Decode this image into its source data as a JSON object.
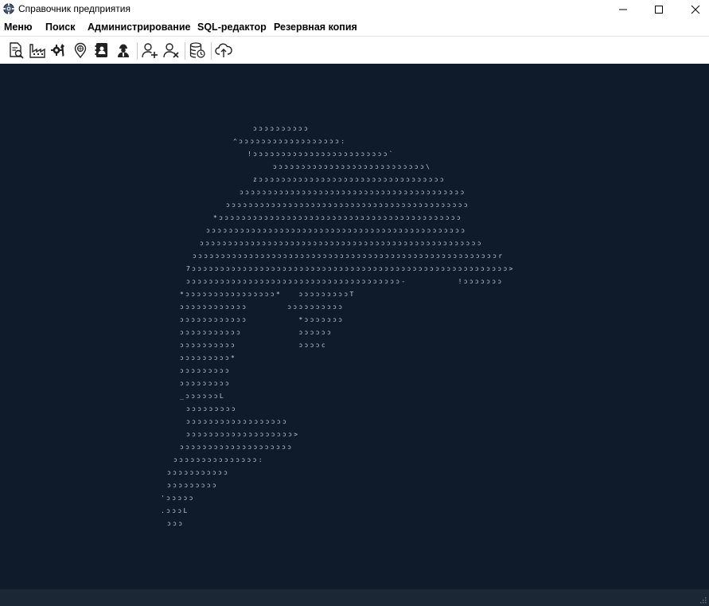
{
  "window": {
    "title": "Справочник предприятия",
    "minimize_glyph": "—",
    "maximize_glyph": "☐",
    "close_glyph": "✕"
  },
  "menu": {
    "items": [
      "Меню",
      "Поиск",
      "Администрирование",
      "SQL-редактор",
      "Резервная копия"
    ]
  },
  "toolbar": {
    "icons": [
      "search-document-icon",
      "factory-icon",
      "tools-icon",
      "location-pin-icon",
      "address-book-icon",
      "worker-icon",
      "add-user-icon",
      "remove-user-icon",
      "database-clock-icon",
      "cloud-upload-icon"
    ]
  },
  "ascii_art": {
    "lines": [
      "          ",
      "",
      "",
      "",
      "",
      "",
      "",
      "",
      "",
      "",
      "",
      "",
      "",
      "",
      "",
      "",
      "",
      "",
      "",
      "",
      "",
      "",
      "",
      "",
      "",
      "",
      "",
      "",
      "",
      "",
      "",
      ""
    ],
    "rows": [
      "ɔɔɔɔɔɔɔɔɔɔ",
      "^ɔɔɔɔɔɔɔɔɔɔɔɔɔɔɔɔɔɔ:",
      "!ɔɔɔɔɔɔɔɔɔɔɔɔɔɔɔɔɔɔɔɔɔɔɔɔ`",
      "ɔɔɔɔɔɔɔɔɔɔɔɔɔɔɔɔɔɔɔɔɔɔɔɔɔɔɔ\\",
      "zɔɔɔɔɔɔɔɔɔɔɔɔɔɔɔɔɔɔɔɔɔɔɔɔɔɔɔɔɔɔɔɔɔ",
      "ɔɔɔɔɔɔɔɔɔɔɔɔɔɔɔɔɔɔɔɔɔɔɔɔɔɔɔɔɔɔɔɔɔɔɔɔɔɔɔɔ",
      "ɔɔɔɔɔɔɔɔɔɔɔɔɔɔɔɔɔɔɔɔɔɔɔɔɔɔɔɔɔɔɔɔɔɔɔɔɔɔɔɔɔɔɔ",
      "*ɔɔɔɔɔɔɔɔɔɔɔɔɔɔɔɔɔɔɔɔɔɔɔɔɔɔɔɔɔɔɔɔɔɔɔɔɔɔɔɔɔɔɔ",
      "ɔɔɔɔɔɔɔɔɔɔɔɔɔɔɔɔɔɔɔɔɔɔɔɔɔɔɔɔɔɔɔɔɔɔɔɔɔɔɔɔɔɔɔɔɔɔ",
      "ɔɔɔɔɔɔɔɔɔɔɔɔɔɔɔɔɔɔɔɔɔɔɔɔɔɔɔɔɔɔɔɔɔɔɔɔɔɔɔɔɔɔɔɔɔɔɔɔɔɔ",
      "ɔɔɔɔɔɔɔɔɔɔɔɔɔɔɔɔɔɔɔɔɔɔɔɔɔɔɔɔɔɔɔɔɔɔɔɔɔɔɔɔɔɔɔɔɔɔɔɔɔɔɔɔɔɔr",
      "7ɔɔɔɔɔɔɔɔɔɔɔɔɔɔɔɔɔɔɔɔɔɔɔɔɔɔɔɔɔɔɔɔɔɔɔɔɔɔɔɔɔɔɔɔɔɔɔɔɔɔɔɔɔɔɔɔ>",
      "ɔɔɔɔɔɔɔɔɔɔɔɔɔɔɔɔɔɔɔɔɔɔɔɔɔɔɔɔɔɔɔɔɔɔɔɔɔɔ-         !ɔɔɔɔɔɔɔ",
      "*ɔɔɔɔɔɔɔɔɔɔɔɔɔɔɔɔ*   ɔɔɔɔɔɔɔɔɔT",
      "ɔɔɔɔɔɔɔɔɔɔɔɔ       ɔɔɔɔɔɔɔɔɔɔ",
      "ɔɔɔɔɔɔɔɔɔɔɔɔ         *ɔɔɔɔɔɔɔ",
      "ɔɔɔɔɔɔɔɔɔɔɔ          ɔɔɔɔɔɔ",
      "ɔɔɔɔɔɔɔɔɔɔ           ɔɔɔɔc",
      "ɔɔɔɔɔɔɔɔɔ*",
      "ɔɔɔɔɔɔɔɔɔ",
      "ɔɔɔɔɔɔɔɔɔ",
      "_ɔɔɔɔɔɔL",
      "ɔɔɔɔɔɔɔɔɔ",
      "ɔɔɔɔɔɔɔɔɔɔɔɔɔɔɔɔɔɔ",
      "ɔɔɔɔɔɔɔɔɔɔɔɔɔɔɔɔɔɔɔ>",
      "ɔɔɔɔɔɔɔɔɔɔɔɔɔɔɔɔɔɔɔɔ",
      "ɔɔɔɔɔɔɔɔɔɔɔɔɔɔɔ:",
      "ɔɔɔɔɔɔɔɔɔɔɔ",
      "ɔɔɔɔɔɔɔɔɔ",
      "'ɔɔɔɔɔ",
      ".ɔɔɔL",
      "ɔɔɔ"
    ]
  },
  "colors": {
    "main_background": "#0f1b2a",
    "art_color": "#c3ccd6",
    "status_background": "#1b2735"
  }
}
